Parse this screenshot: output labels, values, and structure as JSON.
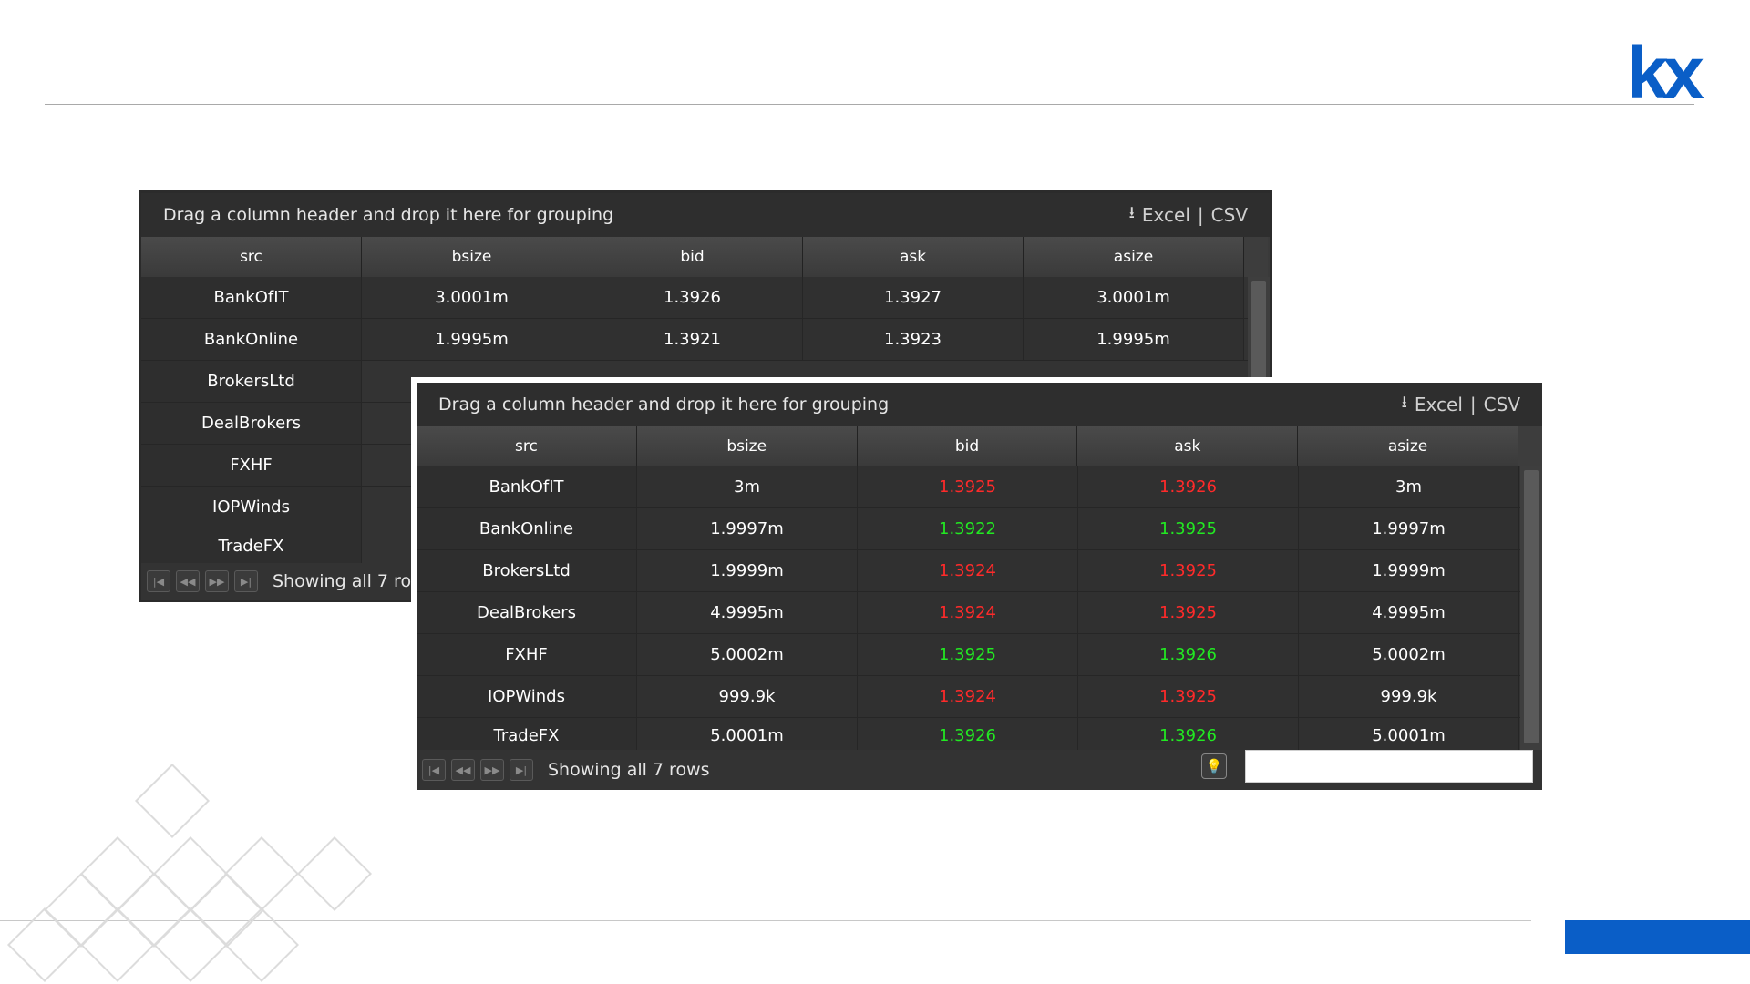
{
  "brand": {
    "logo_text": "kx",
    "accent": "#0a5ec7"
  },
  "grid_back": {
    "group_hint": "Drag a column header and drop it here for grouping",
    "export": {
      "excel": "Excel",
      "sep": "|",
      "csv": "CSV",
      "icon": "download-icon"
    },
    "columns": [
      "src",
      "bsize",
      "bid",
      "ask",
      "asize"
    ],
    "rows": [
      [
        "BankOfIT",
        "3.0001m",
        "1.3926",
        "1.3927",
        "3.0001m"
      ],
      [
        "BankOnline",
        "1.9995m",
        "1.3921",
        "1.3923",
        "1.9995m"
      ],
      [
        "BrokersLtd",
        "",
        "",
        "",
        ""
      ],
      [
        "DealBrokers",
        "",
        "",
        "",
        ""
      ],
      [
        "FXHF",
        "",
        "",
        "",
        ""
      ],
      [
        "IOPWinds",
        "",
        "",
        "",
        ""
      ],
      [
        "TradeFX",
        "",
        "",
        "",
        ""
      ]
    ],
    "pager_text": "Showing all 7 rows"
  },
  "grid_front": {
    "group_hint": "Drag a column header and drop it here for grouping",
    "export": {
      "excel": "Excel",
      "sep": "|",
      "csv": "CSV",
      "icon": "download-icon"
    },
    "columns": [
      "src",
      "bsize",
      "bid",
      "ask",
      "asize"
    ],
    "rows": [
      {
        "cells": [
          "BankOfIT",
          "3m",
          "1.3925",
          "1.3926",
          "3m"
        ],
        "dir": "down"
      },
      {
        "cells": [
          "BankOnline",
          "1.9997m",
          "1.3922",
          "1.3925",
          "1.9997m"
        ],
        "dir": "up"
      },
      {
        "cells": [
          "BrokersLtd",
          "1.9999m",
          "1.3924",
          "1.3925",
          "1.9999m"
        ],
        "dir": "down"
      },
      {
        "cells": [
          "DealBrokers",
          "4.9995m",
          "1.3924",
          "1.3925",
          "4.9995m"
        ],
        "dir": "down"
      },
      {
        "cells": [
          "FXHF",
          "5.0002m",
          "1.3925",
          "1.3926",
          "5.0002m"
        ],
        "dir": "up"
      },
      {
        "cells": [
          "IOPWinds",
          "999.9k",
          "1.3924",
          "1.3925",
          "999.9k"
        ],
        "dir": "down"
      },
      {
        "cells": [
          "TradeFX",
          "5.0001m",
          "1.3926",
          "1.3926",
          "5.0001m"
        ],
        "dir": "up"
      }
    ],
    "pager_text": "Showing all 7 rows",
    "search_value": "",
    "colors": {
      "down": "#ff2a2a",
      "up": "#22e822"
    }
  }
}
